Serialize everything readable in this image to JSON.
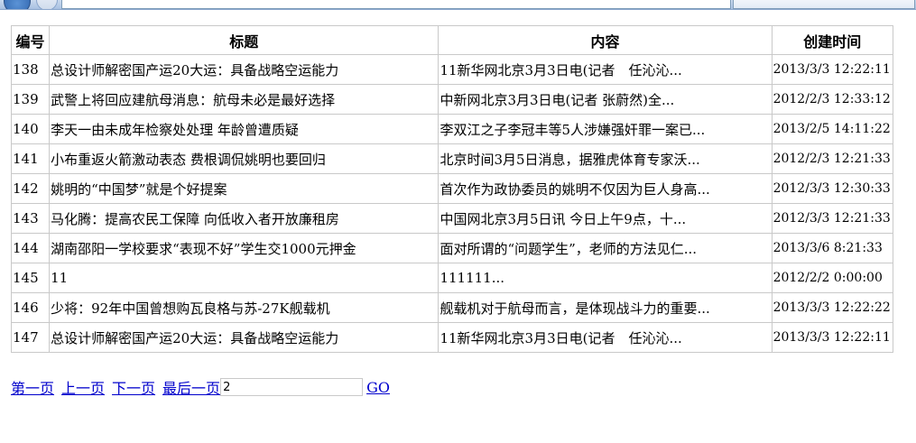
{
  "table": {
    "headers": {
      "id": "编号",
      "title": "标题",
      "content": "内容",
      "created": "创建时间"
    },
    "rows": [
      {
        "id": "138",
        "title": "总设计师解密国产运20大运：具备战略空运能力",
        "content": "11新华网北京3月3日电(记者　任沁沁...",
        "created": "2013/3/3 12:22:11"
      },
      {
        "id": "139",
        "title": "武警上将回应建航母消息：航母未必是最好选择",
        "content": "中新网北京3月3日电(记者 张蔚然)全...",
        "created": "2012/2/3 12:33:12"
      },
      {
        "id": "140",
        "title": "李天一由未成年检察处处理 年龄曾遭质疑",
        "content": "李双江之子李冠丰等5人涉嫌强奸罪一案已...",
        "created": "2013/2/5 14:11:22"
      },
      {
        "id": "141",
        "title": "小布重返火箭激动表态 费根调侃姚明也要回归",
        "content": "北京时间3月5日消息，据雅虎体育专家沃...",
        "created": "2012/2/3 12:21:33"
      },
      {
        "id": "142",
        "title": "姚明的“中国梦”就是个好提案",
        "content": "首次作为政协委员的姚明不仅因为巨人身高...",
        "created": "2012/3/3 12:30:33"
      },
      {
        "id": "143",
        "title": "马化腾：提高农民工保障 向低收入者开放廉租房",
        "content": "中国网北京3月5日讯 今日上午9点，十...",
        "created": "2012/3/3 12:21:33"
      },
      {
        "id": "144",
        "title": "湖南邵阳一学校要求“表现不好”学生交1000元押金",
        "content": "面对所谓的“问题学生”，老师的方法见仁...",
        "created": "2013/3/6 8:21:33"
      },
      {
        "id": "145",
        "title": "11",
        "content": "111111...",
        "created": "2012/2/2 0:00:00"
      },
      {
        "id": "146",
        "title": "少将：92年中国曾想购瓦良格与苏-27K舰载机",
        "content": "舰载机对于航母而言，是体现战斗力的重要...",
        "created": "2013/3/3 12:22:22"
      },
      {
        "id": "147",
        "title": "总设计师解密国产运20大运：具备战略空运能力",
        "content": "11新华网北京3月3日电(记者　任沁沁...",
        "created": "2013/3/3 12:22:11"
      }
    ]
  },
  "pager": {
    "first": "第一页",
    "prev": "上一页",
    "next": "下一页",
    "last": "最后一页",
    "page_value": "2",
    "go": "GO"
  },
  "colors": {
    "link": "#0000cc",
    "border": "#c9c9c9"
  }
}
